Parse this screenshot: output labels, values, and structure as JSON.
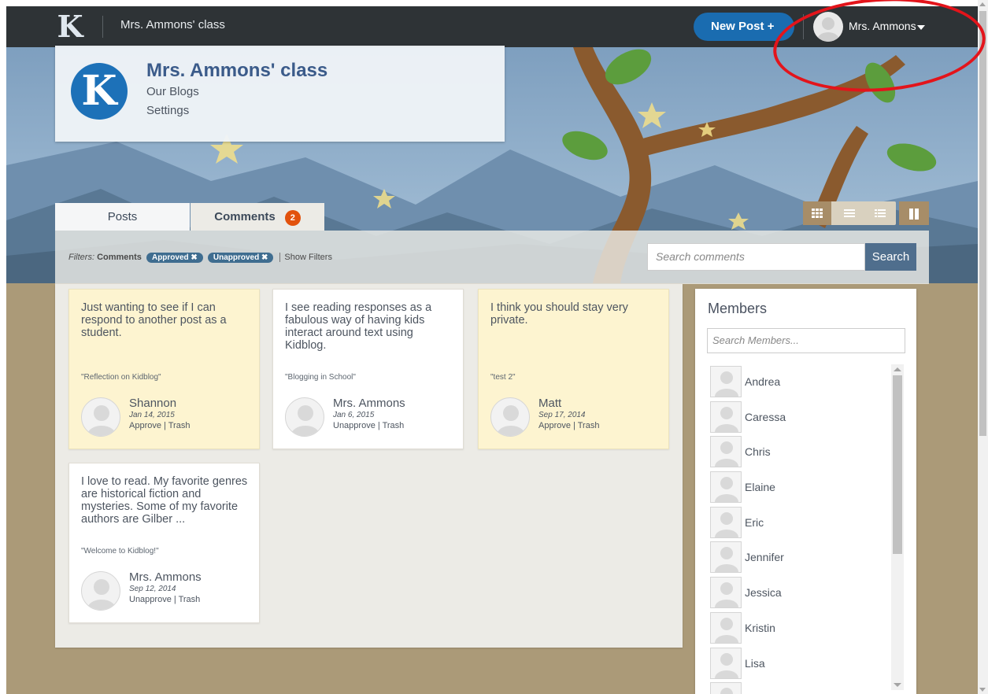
{
  "topbar": {
    "logo": "K",
    "class_title": "Mrs. Ammons' class",
    "new_post_label": "New Post",
    "new_post_plus": "+",
    "user_name": "Mrs. Ammons"
  },
  "header": {
    "logo": "K",
    "title": "Mrs. Ammons' class",
    "links": [
      "Our Blogs",
      "Settings"
    ]
  },
  "tabs": [
    {
      "label": "Posts"
    },
    {
      "label": "Comments",
      "badge": "2"
    }
  ],
  "filters": {
    "label": "Filters:",
    "type": "Comments",
    "chips": [
      "Approved ✖",
      "Unapproved ✖"
    ],
    "show_filters": "Show Filters",
    "search_placeholder": "Search comments",
    "search_button": "Search"
  },
  "comments": [
    {
      "text": "Just wanting to see if I can respond to another post as a student.",
      "post": "\"Reflection on Kidblog\"",
      "author": "Shannon",
      "date": "Jan 14, 2015",
      "actions": "Approve | Trash",
      "status": "unapproved"
    },
    {
      "text": "I see reading responses as a fabulous way of having kids interact around text using Kidblog.",
      "post": "\"Blogging in School\"",
      "author": "Mrs. Ammons",
      "date": "Jan 6, 2015",
      "actions": "Unapprove | Trash",
      "status": "approved"
    },
    {
      "text": "I think you should stay very private.",
      "post": "\"test 2\"",
      "author": "Matt",
      "date": "Sep 17, 2014",
      "actions": "Approve | Trash",
      "status": "unapproved"
    },
    {
      "text": "I love to read. My favorite genres are historical fiction and mysteries. Some of my favorite authors are Gilber ...",
      "post": "\"Welcome to Kidblog!\"",
      "author": "Mrs. Ammons",
      "date": "Sep 12, 2014",
      "actions": "Unapprove | Trash",
      "status": "approved"
    }
  ],
  "members": {
    "title": "Members",
    "search_placeholder": "Search Members...",
    "list": [
      "Andrea",
      "Caressa",
      "Chris",
      "Elaine",
      "Eric",
      "Jennifer",
      "Jessica",
      "Kristin",
      "Lisa"
    ]
  },
  "colors": {
    "topbar": "#2e3336",
    "accent": "#1a6cb0",
    "badge": "#e2520d",
    "unapproved_card": "#fdf4d0",
    "annotation": "#e3141b"
  },
  "icons": {
    "view_buttons": [
      "grid-view-icon",
      "list-view-icon",
      "detail-list-view-icon"
    ],
    "pane_toggle": "sidebar-toggle-icon"
  }
}
